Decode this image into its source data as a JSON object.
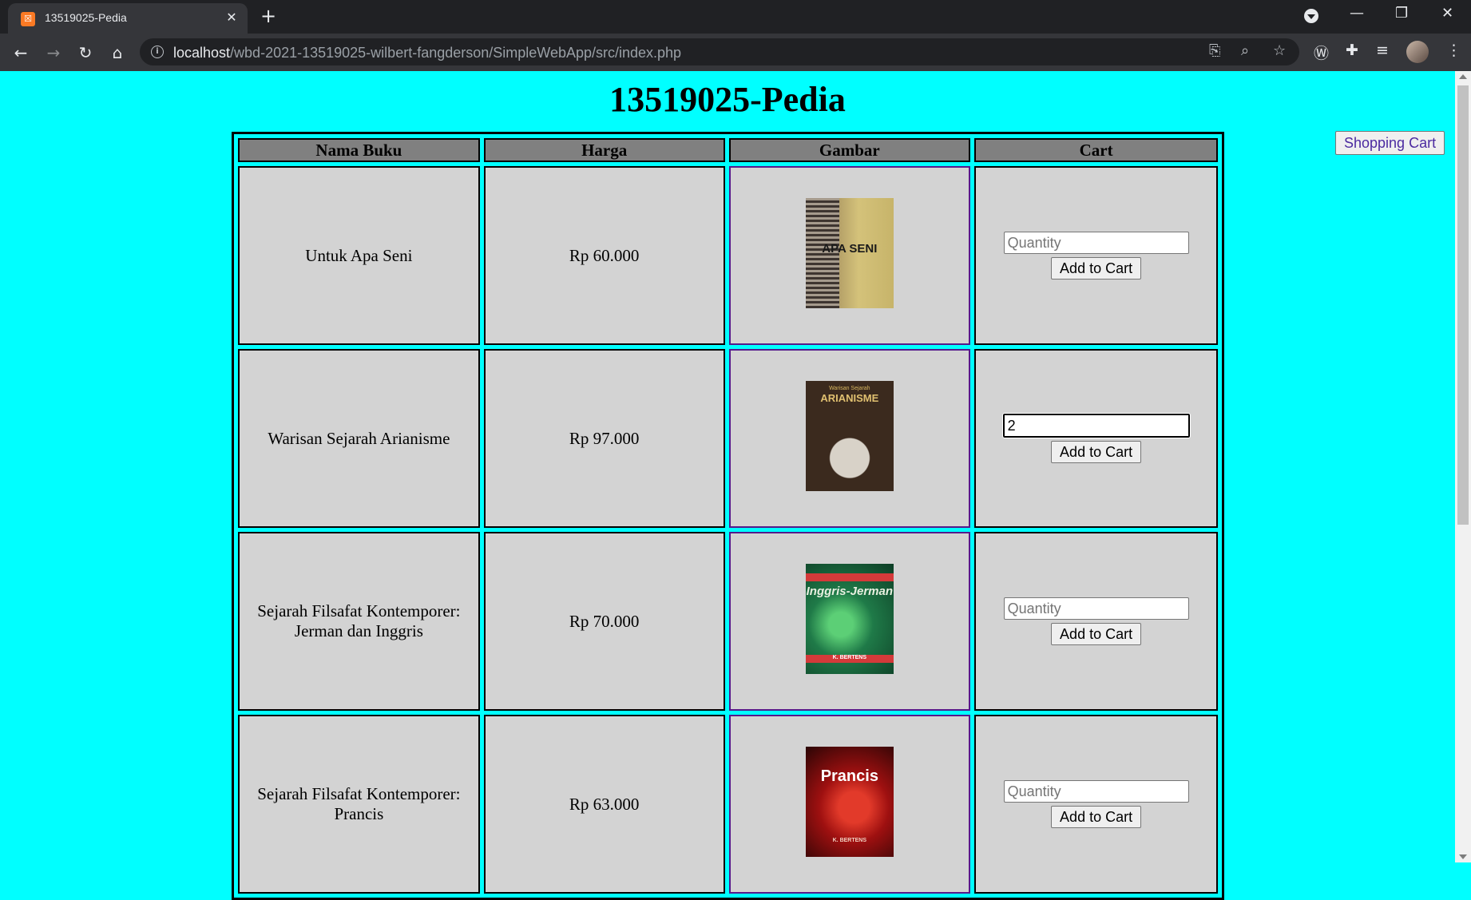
{
  "browser": {
    "tab_title": "13519025-Pedia",
    "url_host": "localhost",
    "url_path": "/wbd-2021-13519025-wilbert-fangderson/SimpleWebApp/src/index.php"
  },
  "page": {
    "title": "13519025-Pedia",
    "cart_button": "Shopping Cart",
    "background": "#00ffff"
  },
  "table": {
    "headers": [
      "Nama Buku",
      "Harga",
      "Gambar",
      "Cart"
    ],
    "rows": [
      {
        "name": "Untuk Apa Seni",
        "price": "Rp 60.000",
        "cover_text": "APA SENI",
        "qty_value": "",
        "qty_placeholder": "Quantity",
        "button": "Add to Cart"
      },
      {
        "name": "Warisan Sejarah Arianisme",
        "price": "Rp 97.000",
        "cover_text": "ARIANISME",
        "qty_value": "2",
        "qty_placeholder": "Quantity",
        "button": "Add to Cart"
      },
      {
        "name": "Sejarah Filsafat Kontemporer: Jerman dan Inggris",
        "price": "Rp 70.000",
        "cover_text": "Inggris-Jerman",
        "qty_value": "",
        "qty_placeholder": "Quantity",
        "button": "Add to Cart"
      },
      {
        "name": "Sejarah Filsafat Kontemporer: Prancis",
        "price": "Rp 63.000",
        "cover_text": "Prancis",
        "qty_value": "",
        "qty_placeholder": "Quantity",
        "button": "Add to Cart"
      }
    ]
  },
  "cover_extra": {
    "row1_label": "Warisan Sejarah",
    "row3_author": "K. BERTENS",
    "row4_author": "K. BERTENS"
  }
}
